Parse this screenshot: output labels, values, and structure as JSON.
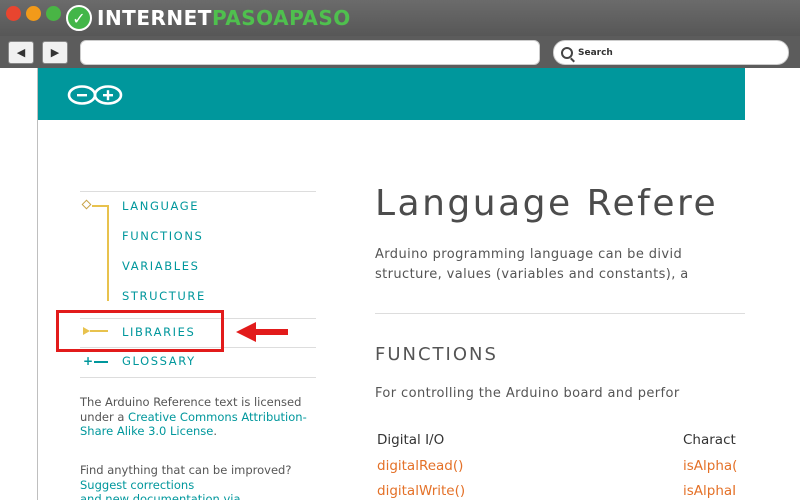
{
  "window": {
    "brand_prefix": "INTERNET",
    "brand_accent": "PASOAPASO",
    "brand_color": "#4fc04e",
    "search_placeholder": "Search"
  },
  "nav": {
    "back_icon": "◀",
    "forward_icon": "▶"
  },
  "header": {
    "color": "#00979c",
    "logo": "arduino-infinity-logo"
  },
  "sidebar": {
    "items": [
      {
        "label": "LANGUAGE"
      },
      {
        "label": "FUNCTIONS"
      },
      {
        "label": "VARIABLES"
      },
      {
        "label": "STRUCTURE"
      },
      {
        "label": "LIBRARIES"
      },
      {
        "label": "GLOSSARY"
      }
    ],
    "license_note": {
      "prefix": "The Arduino Reference text is licensed under a ",
      "link": "Creative Commons Attribution-Share Alike 3.0 License",
      "suffix": "."
    },
    "improve_note": {
      "prefix": "Find anything that can be improved? ",
      "link1": "Suggest corrections",
      "line3": "and new documentation via"
    }
  },
  "main": {
    "title": "Language Refere",
    "intro_line1": "Arduino programming language can be divid",
    "intro_line2": "structure, values (variables and constants), a",
    "section_title": "FUNCTIONS",
    "section_desc": "For controlling the Arduino board and perfor",
    "columns": [
      {
        "header": "Digital I/O",
        "items": [
          "digitalRead()",
          "digitalWrite()"
        ]
      },
      {
        "header": "Charact",
        "items": [
          "isAlpha(",
          "isAlphaI"
        ]
      }
    ]
  },
  "annotation": {
    "highlight_color": "#e21b1b"
  }
}
